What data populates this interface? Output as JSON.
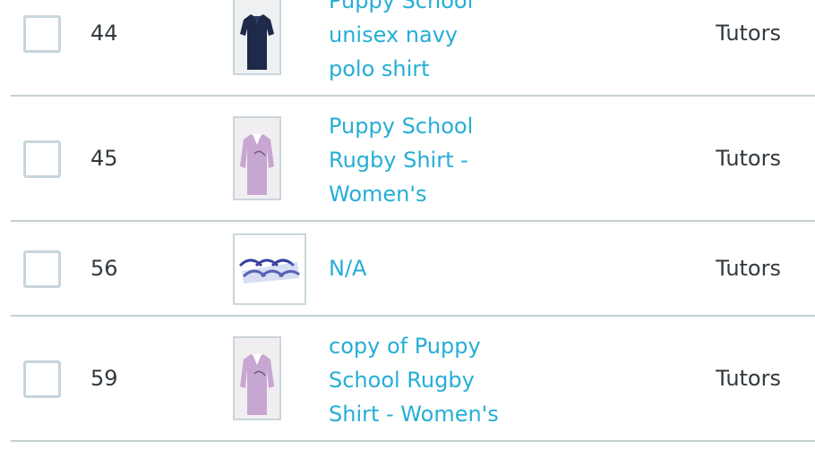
{
  "rows": [
    {
      "id": "44",
      "name": "Puppy School unisex navy polo shirt",
      "group": "Tutors",
      "thumbnail_icon": "navy-polo-shirt-thumbnail"
    },
    {
      "id": "45",
      "name": "Puppy School Rugby Shirt - Women's",
      "group": "Tutors",
      "thumbnail_icon": "pink-rugby-shirt-thumbnail"
    },
    {
      "id": "56",
      "name": "N/A",
      "group": "Tutors",
      "thumbnail_icon": "blue-white-pattern-thumbnail"
    },
    {
      "id": "59",
      "name": "copy of Puppy School Rugby Shirt - Women's",
      "group": "Tutors",
      "thumbnail_icon": "pink-rugby-shirt-thumbnail"
    }
  ],
  "colors": {
    "link": "#25aed6",
    "text": "#333a3f",
    "divider": "#c5d0d4",
    "checkbox_border": "#c8d5dd"
  }
}
